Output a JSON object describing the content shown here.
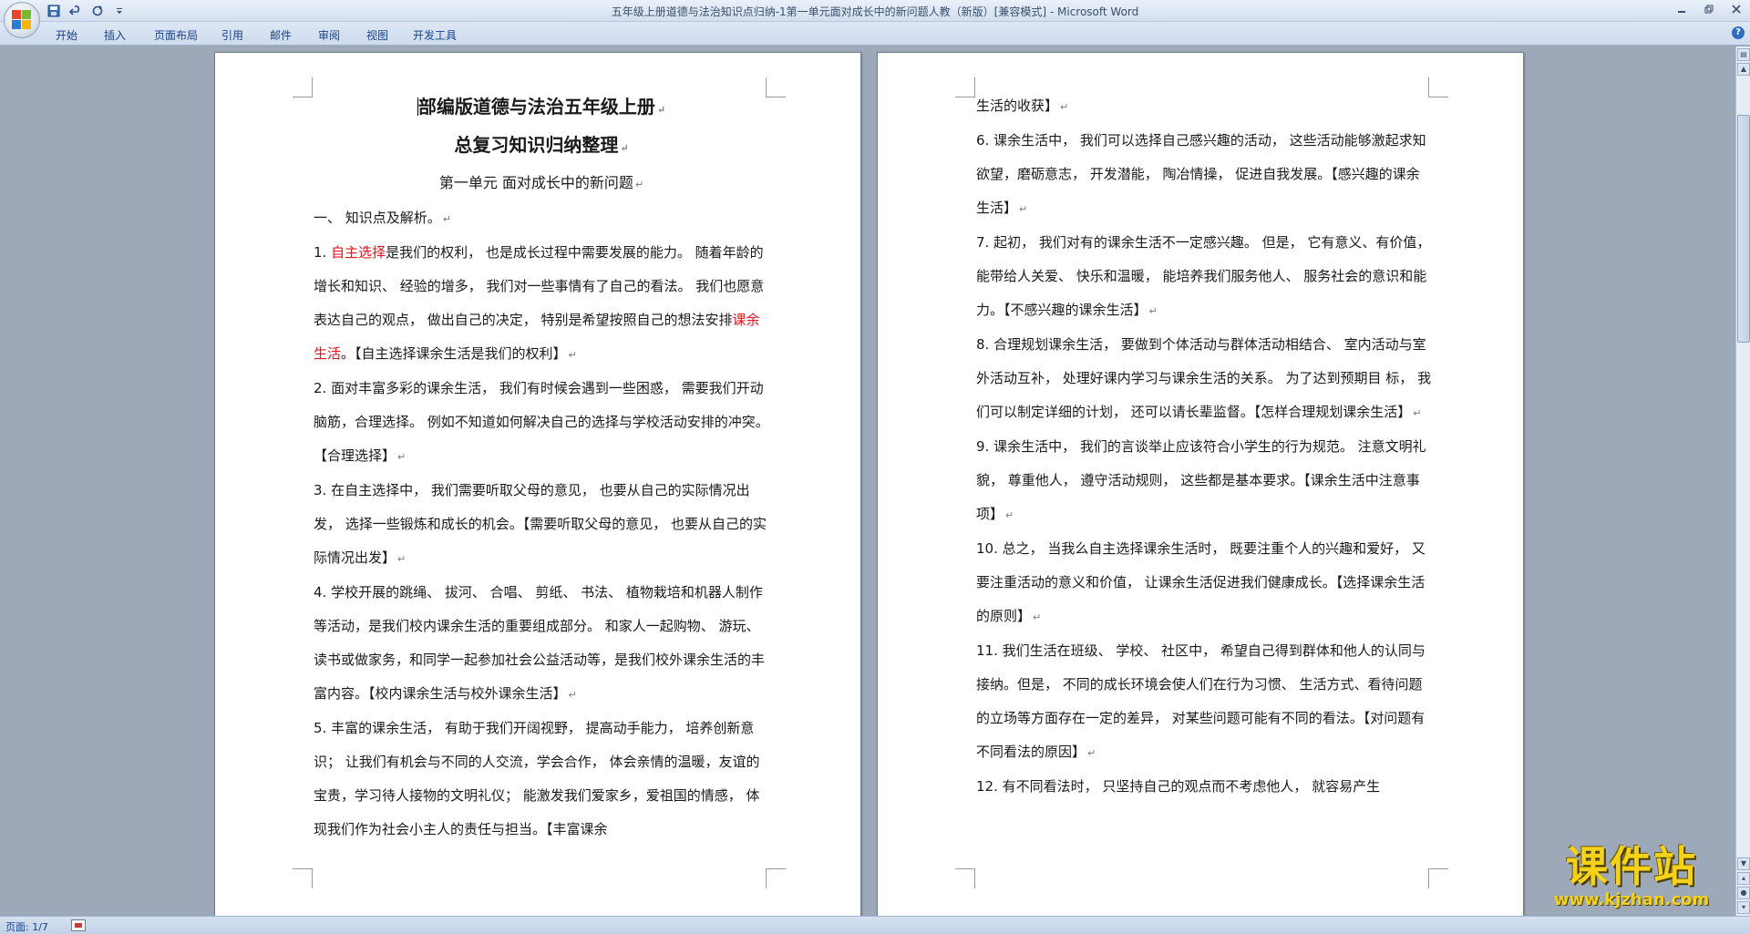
{
  "window": {
    "title": "五年级上册道德与法治知识点归纳-1第一单元面对成长中的新问题人教（新版）[兼容模式] - Microsoft Word"
  },
  "quick_access": [
    "save-icon",
    "undo-icon",
    "redo-icon",
    "customize-icon"
  ],
  "ribbon": {
    "tabs": [
      "开始",
      "插入",
      "页面布局",
      "引用",
      "邮件",
      "审阅",
      "视图",
      "开发工具"
    ]
  },
  "page1": {
    "title_line1": "部编版道德与法治五年级上册",
    "title_line2": "总复习知识归纳整理",
    "unit": "第一单元 面对成长中的新问题",
    "section": "一、 知识点及解析。",
    "p1_num": "1. ",
    "p1_red1": "自主选择",
    "p1_a": "是我们的权利， 也是成长过程中需要发展的能力。 随着年龄的增长和知识、 经验的增多， 我们对一些事情有了自己的看法。 我们也愿意表达自己的观点， 做出自己的决定， 特别是希望按照自己的想法安排",
    "p1_red2": "课余生活",
    "p1_b": "。【自主选择课余生活是我们的权利】",
    "p2": "2. 面对丰富多彩的课余生活， 我们有时候会遇到一些困惑， 需要我们开动脑筋，合理选择。 例如不知道如何解决自己的选择与学校活动安排的冲突。【合理选择】",
    "p3": "3. 在自主选择中， 我们需要听取父母的意见， 也要从自己的实际情况出发， 选择一些锻炼和成长的机会。【需要听取父母的意见， 也要从自己的实际情况出发】",
    "p4": "4. 学校开展的跳绳、 拔河、 合唱、 剪纸、 书法、 植物栽培和机器人制作等活动，是我们校内课余生活的重要组成部分。 和家人一起购物、 游玩、 读书或做家务，和同学一起参加社会公益活动等，是我们校外课余生活的丰富内容。【校内课余生活与校外课余生活】",
    "p5": "5. 丰富的课余生活， 有助于我们开阔视野， 提高动手能力， 培养创新意识； 让我们有机会与不同的人交流，学会合作， 体会亲情的温暖，友谊的宝贵，学习待人接物的文明礼仪； 能激发我们爱家乡，爱祖国的情感， 体现我们作为社会小主人的责任与担当。【丰富课余"
  },
  "page2": {
    "p5_cont": "生活的收获】",
    "p6": "6. 课余生活中， 我们可以选择自己感兴趣的活动， 这些活动能够激起求知欲望，磨砺意志， 开发潜能， 陶冶情操， 促进自我发展。【感兴趣的课余生活】",
    "p7": "7. 起初， 我们对有的课余生活不一定感兴趣。 但是， 它有意义、有价值， 能带给人关爱、 快乐和温暖， 能培养我们服务他人、 服务社会的意识和能力。【不感兴趣的课余生活】",
    "p8": "8. 合理规划课余生活， 要做到个体活动与群体活动相结合、 室内活动与室外活动互补， 处理好课内学习与课余生活的关系。 为了达到预期目 标， 我们可以制定详细的计划， 还可以请长辈监督。【怎样合理规划课余生活】",
    "p9": "9. 课余生活中， 我们的言谈举止应该符合小学生的行为规范。 注意文明礼貌， 尊重他人， 遵守活动规则， 这些都是基本要求。【课余生活中注意事项】",
    "p10": "10. 总之， 当我么自主选择课余生活时， 既要注重个人的兴趣和爱好， 又要注重活动的意义和价值， 让课余生活促进我们健康成长。【选择课余生活的原则】",
    "p11": "11. 我们生活在班级、 学校、 社区中， 希望自己得到群体和他人的认同与接纳。但是， 不同的成长环境会使人们在行为习惯、 生活方式、看待问题的立场等方面存在一定的差异， 对某些问题可能有不同的看法。【对问题有不同看法的原因】",
    "p12": "12. 有不同看法时， 只坚持自己的观点而不考虑他人， 就容易产生"
  },
  "paragraph_mark": "↵",
  "status": {
    "page": "页面: 1/7"
  },
  "watermark": {
    "title": "课件站",
    "url": "www.kjzhan.com"
  }
}
